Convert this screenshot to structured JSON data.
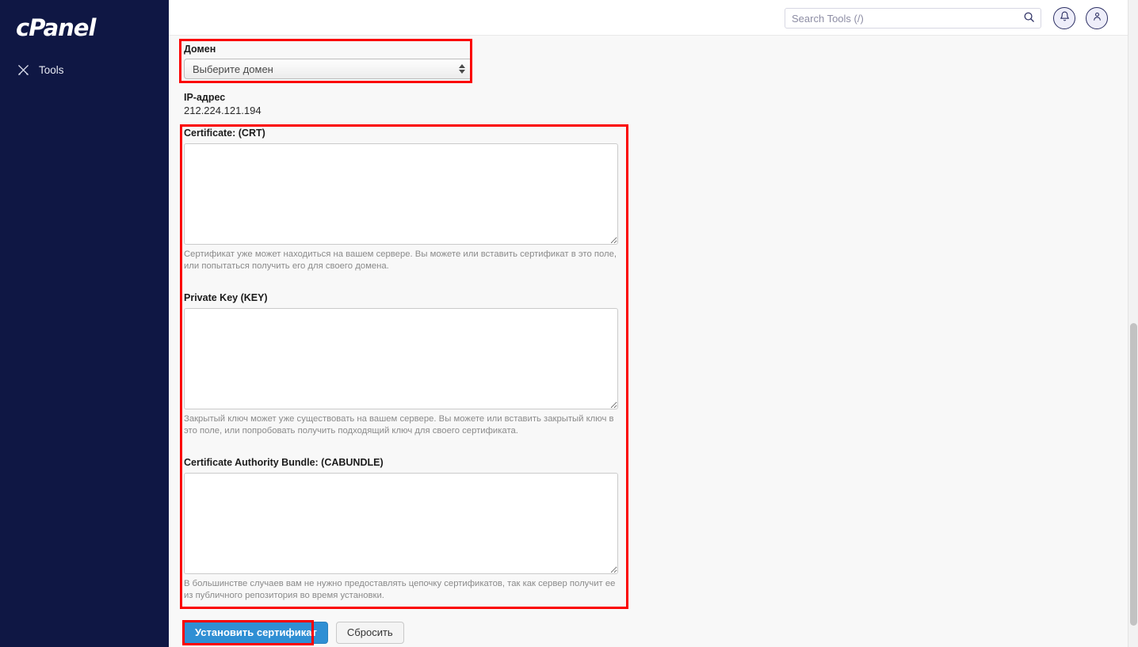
{
  "sidebar": {
    "brand": "cPanel",
    "items": [
      {
        "label": "Tools",
        "icon": "tools-icon"
      }
    ]
  },
  "header": {
    "search": {
      "placeholder": "Search Tools (/)",
      "value": "",
      "icon": "search-icon"
    },
    "notifications_icon": "bell-icon",
    "account_icon": "user-icon"
  },
  "main": {
    "domain": {
      "label": "Домен",
      "selected": "Выберите домен",
      "options": [
        "Выберите домен"
      ]
    },
    "ip": {
      "label": "IP-адрес",
      "value": "212.224.121.194"
    },
    "certificate": {
      "label": "Certificate: (CRT)",
      "value": "",
      "help": "Сертификат уже может находиться на вашем сервере. Вы можете или вставить сертификат в это поле, или попытаться получить его для своего домена."
    },
    "private_key": {
      "label": "Private Key (KEY)",
      "value": "",
      "help": "Закрытый ключ может уже существовать на вашем сервере. Вы можете или вставить закрытый ключ в это поле, или попробовать получить подходящий ключ для своего сертификата."
    },
    "ca_bundle": {
      "label": "Certificate Authority Bundle: (CABUNDLE)",
      "value": "",
      "help": "В большинстве случаев вам не нужно предоставлять цепочку сертификатов, так как сервер получит ее из публичного репозитория во время установки."
    },
    "actions": {
      "install_label": "Установить сертификат",
      "reset_label": "Сбросить"
    }
  },
  "colors": {
    "sidebar_bg": "#0f1744",
    "primary_button": "#2f8fd4",
    "highlight": "#fb0000",
    "content_bg": "#f8f8f8"
  }
}
